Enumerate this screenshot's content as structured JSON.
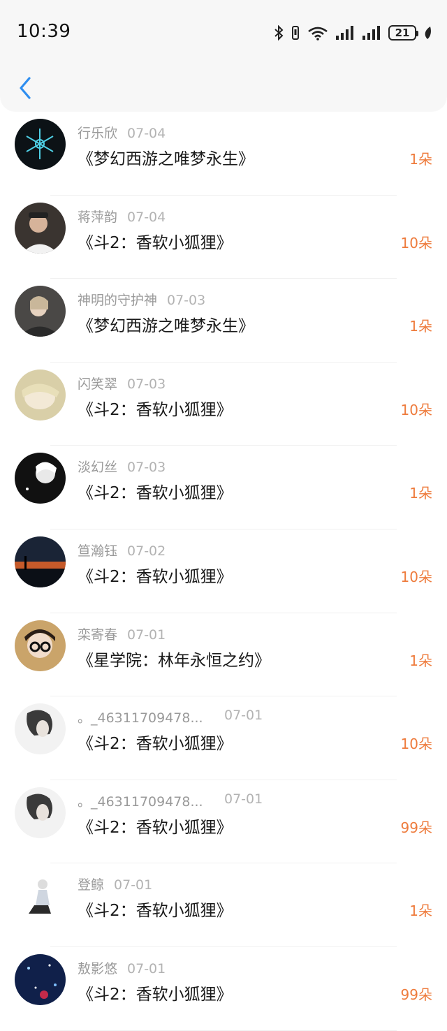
{
  "status_bar": {
    "time": "10:39",
    "battery": "21"
  },
  "nav": {
    "back_icon": "chevron-left-icon"
  },
  "colors": {
    "accent": "#2e8ef0",
    "amount": "#ee7b3c"
  },
  "records": [
    {
      "name": "行乐欣",
      "date": "07-04",
      "title": "《梦幻西游之唯梦永生》",
      "amount": "1朵"
    },
    {
      "name": "蒋萍韵",
      "date": "07-04",
      "title": "《斗2：香软小狐狸》",
      "amount": "10朵"
    },
    {
      "name": "神明的守护神",
      "date": "07-03",
      "title": "《梦幻西游之唯梦永生》",
      "amount": "1朵"
    },
    {
      "name": "闪笑翠",
      "date": "07-03",
      "title": "《斗2：香软小狐狸》",
      "amount": "10朵"
    },
    {
      "name": "淡幻丝",
      "date": "07-03",
      "title": "《斗2：香软小狐狸》",
      "amount": "1朵"
    },
    {
      "name": "笪瀚钰",
      "date": "07-02",
      "title": "《斗2：香软小狐狸》",
      "amount": "10朵"
    },
    {
      "name": "栾寄春",
      "date": "07-01",
      "title": "《星学院：林年永恒之约》",
      "amount": "1朵"
    },
    {
      "name": "。_46311709478...",
      "date": "07-01",
      "title": "《斗2：香软小狐狸》",
      "amount": "10朵"
    },
    {
      "name": "。_46311709478...",
      "date": "07-01",
      "title": "《斗2：香软小狐狸》",
      "amount": "99朵"
    },
    {
      "name": "登鲸",
      "date": "07-01",
      "title": "《斗2：香软小狐狸》",
      "amount": "1朵"
    },
    {
      "name": "敖影悠",
      "date": "07-01",
      "title": "《斗2：香软小狐狸》",
      "amount": "99朵"
    }
  ]
}
